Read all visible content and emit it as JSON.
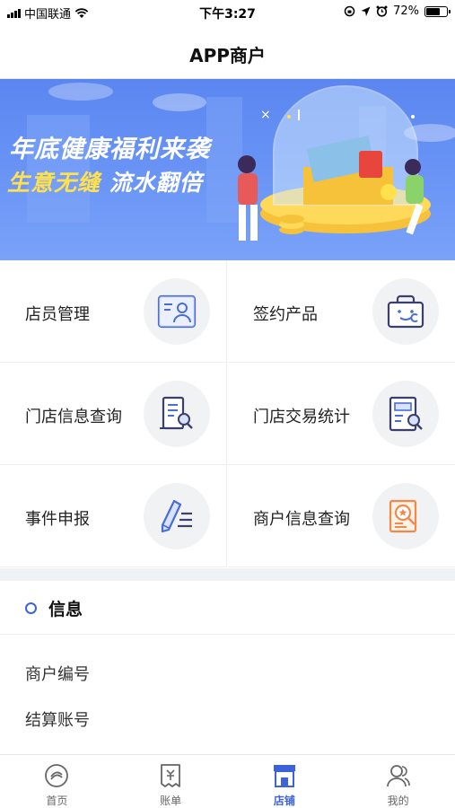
{
  "status_bar": {
    "carrier": "中国联通",
    "time": "下午3:27",
    "battery_percent": "72%",
    "battery_level": 0.72,
    "icons": [
      "signal-icon",
      "wifi-icon",
      "rotation-lock-icon",
      "location-icon",
      "alarm-icon",
      "battery-icon"
    ]
  },
  "nav": {
    "title": "APP商户"
  },
  "banner": {
    "line1": "年底健康福利来袭",
    "line2_yellow": "生意无缝",
    "line2_white": "流水翻倍"
  },
  "grid": {
    "items": [
      {
        "label": "店员管理",
        "icon": "staff-card-icon"
      },
      {
        "label": "签约产品",
        "icon": "product-bag-icon"
      },
      {
        "label": "门店信息查询",
        "icon": "store-search-icon"
      },
      {
        "label": "门店交易统计",
        "icon": "transaction-stats-icon"
      },
      {
        "label": "事件申报",
        "icon": "pen-report-icon"
      },
      {
        "label": "商户信息查询",
        "icon": "merchant-search-icon"
      }
    ]
  },
  "info": {
    "title": "信息",
    "rows": [
      "商户编号",
      "结算账号"
    ]
  },
  "tab_bar": {
    "tabs": [
      {
        "label": "首页",
        "icon": "home-icon",
        "active": false
      },
      {
        "label": "账单",
        "icon": "bill-icon",
        "active": false
      },
      {
        "label": "店铺",
        "icon": "store-icon",
        "active": true
      },
      {
        "label": "我的",
        "icon": "user-icon",
        "active": false
      }
    ]
  },
  "colors": {
    "accent": "#3c63d8",
    "banner_bg": "#6a95f6",
    "banner_highlight": "#ffe14d",
    "icon_circle_bg": "#f1f2f4",
    "icon_orange": "#f08a4b"
  }
}
